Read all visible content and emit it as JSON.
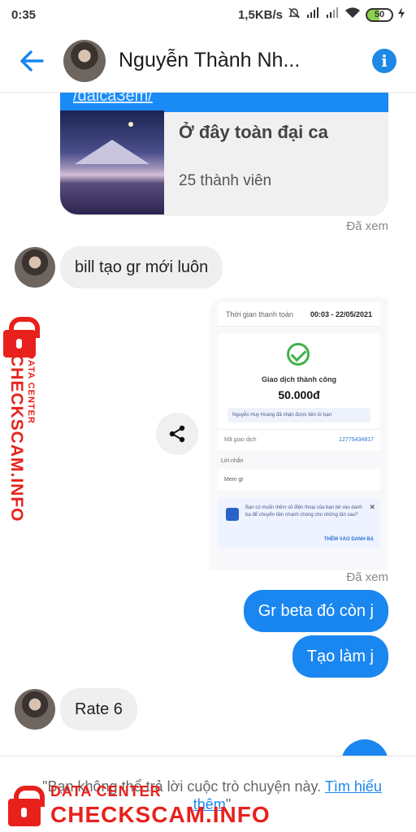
{
  "status_bar": {
    "time": "0:35",
    "speed": "1,5KB/s",
    "battery": "50"
  },
  "header": {
    "title": "Nguyễn Thành Nh..."
  },
  "messages": {
    "card_link": "/daica3em/",
    "card_title": "Ở đây toàn đại ca",
    "card_members": "25 thành viên",
    "seen_1": "Đã xem",
    "in_1": "bill tạo gr mới luôn",
    "seen_2": "Đã xem",
    "out_1": "Gr beta đó còn j",
    "out_2": "Tạo làm j",
    "in_2": "Rate 6"
  },
  "receipt": {
    "time_label": "Thời gian thanh toán",
    "time_value": "00:03 - 22/05/2021",
    "status": "Giao dịch thành công",
    "amount": "50.000đ",
    "note": "Nguyễn Huy Hoàng đã nhận được tiền từ bạn",
    "code_label": "Mã giao dịch",
    "code_value": "12775434817",
    "msg_label": "Lời nhắn",
    "msg_value": "Mem gr",
    "ask_text": "Bạn có muốn thêm số điện thoại của bạn bè vào danh bạ để chuyển tiền nhanh chóng cho những lần sau?",
    "add_label": "THÊM VÀO DANH BẠ"
  },
  "footer": {
    "notice": "\"Bạn không thể trả lời cuộc trò chuyện này.",
    "learn_more": "Tìm hiểu thêm",
    "close_quote": "\""
  },
  "watermark": {
    "small": "DATA CENTER",
    "big": "CHECKSCAM.INFO"
  },
  "colors": {
    "accent": "#1a86f0",
    "watermark": "#e8211c"
  }
}
